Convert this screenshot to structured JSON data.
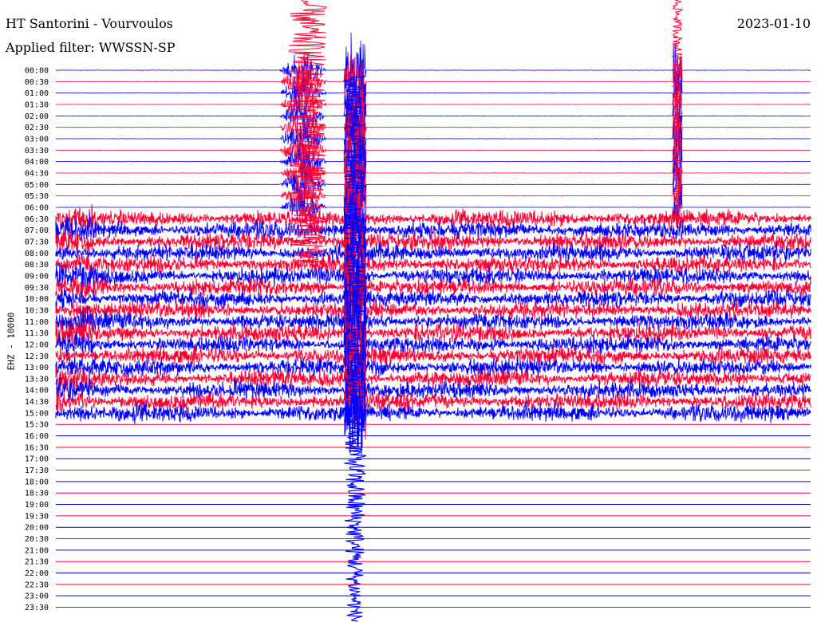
{
  "header": {
    "title": "HT Santorini - Vourvoulos",
    "filter": "Applied filter: WWSSN-SP",
    "date": "2023-01-10"
  },
  "axis": {
    "ylabel": "EHZ - 10000"
  },
  "colors": {
    "blue": "#0000ff",
    "red": "#ff0033",
    "background": "#ffffff"
  },
  "chart_data": {
    "type": "line",
    "title": "HT Santorini - Vourvoulos",
    "subtitle": "Applied filter: WWSSN-SP",
    "date": "2023-01-10",
    "ylabel": "EHZ - 10000",
    "y_ticks": [
      "00:00",
      "00:30",
      "01:00",
      "01:30",
      "02:00",
      "02:30",
      "03:00",
      "03:30",
      "04:00",
      "04:30",
      "05:00",
      "05:30",
      "06:00",
      "06:30",
      "07:00",
      "07:30",
      "08:00",
      "08:30",
      "09:00",
      "09:30",
      "10:00",
      "10:30",
      "11:00",
      "11:30",
      "12:00",
      "12:30",
      "13:00",
      "13:30",
      "14:00",
      "14:30",
      "15:00",
      "15:30",
      "16:00",
      "16:30",
      "17:00",
      "17:30",
      "18:00",
      "18:30",
      "19:00",
      "19:30",
      "20:00",
      "20:30",
      "21:00",
      "21:30",
      "22:00",
      "22:30",
      "23:00",
      "23:30"
    ],
    "trace_colors": [
      "blue",
      "red"
    ],
    "active_until": "15:00",
    "grid": false,
    "legend": "none"
  }
}
